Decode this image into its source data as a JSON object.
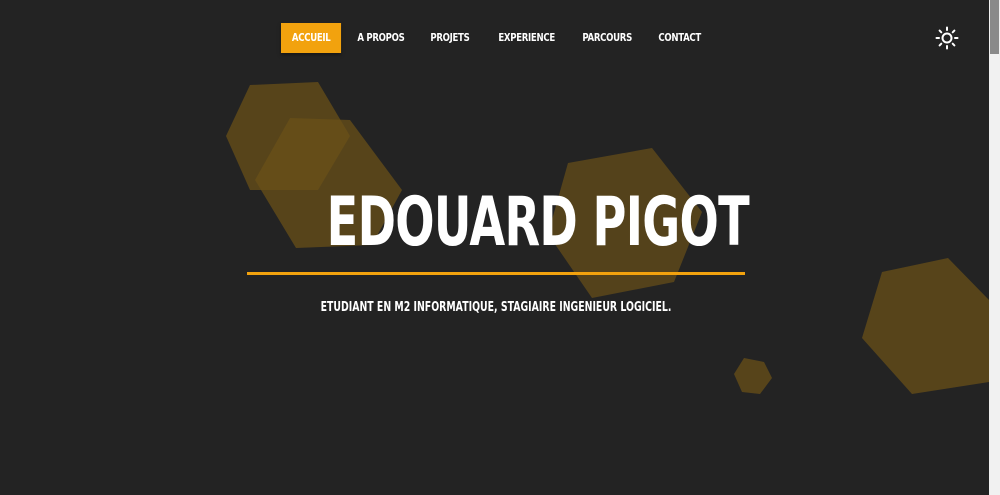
{
  "nav": {
    "items": [
      {
        "label": "ACCUEIL",
        "active": true
      },
      {
        "label": "A PROPOS",
        "active": false
      },
      {
        "label": "PROJETS",
        "active": false
      },
      {
        "label": "EXPERIENCE",
        "active": false
      },
      {
        "label": "PARCOURS",
        "active": false
      },
      {
        "label": "CONTACT",
        "active": false
      }
    ]
  },
  "theme_toggle": {
    "icon": "sun-icon"
  },
  "hero": {
    "title": "EDOUARD PIGOT",
    "subtitle": "ETUDIANT EN M2 INFORMATIQUE, STAGIAIRE INGENIEUR LOGICIEL."
  },
  "colors": {
    "accent": "#f2a20e",
    "background": "#232323",
    "hexagon": "#6a5018",
    "text": "#ffffff"
  }
}
